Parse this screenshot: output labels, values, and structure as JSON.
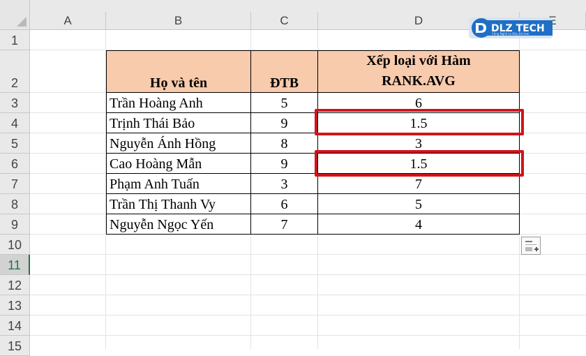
{
  "columns": [
    "A",
    "B",
    "C",
    "D",
    "E"
  ],
  "rows": [
    "1",
    "2",
    "3",
    "4",
    "5",
    "6",
    "7",
    "8",
    "9",
    "10",
    "11",
    "12",
    "13",
    "14",
    "15"
  ],
  "active_row": "11",
  "table": {
    "header": {
      "name": "Họ và tên",
      "score": "ĐTB",
      "rank_line1": "Xếp loại với Hàm",
      "rank_line2": "RANK.AVG"
    },
    "records": [
      {
        "name": "Trần Hoàng Anh",
        "score": "5",
        "rank": "6"
      },
      {
        "name": "Trịnh Thái Bảo",
        "score": "9",
        "rank": "1.5"
      },
      {
        "name": "Nguyễn Ánh Hồng",
        "score": "8",
        "rank": "3"
      },
      {
        "name": "Cao Hoàng Mẫn",
        "score": "9",
        "rank": "1.5"
      },
      {
        "name": "Phạm Anh Tuấn",
        "score": "3",
        "rank": "7"
      },
      {
        "name": "Trần Thị Thanh Vy",
        "score": "6",
        "rank": "5"
      },
      {
        "name": "Nguyễn Ngọc Yến",
        "score": "7",
        "rank": "4"
      }
    ]
  },
  "logo": {
    "text": "DLZ TECH",
    "tagline": "Công Nghệ Là Đây Đủ Hơn"
  },
  "colors": {
    "header_fill": "#f8cbad",
    "highlight": "#d0141c",
    "active_row": "#217346"
  }
}
